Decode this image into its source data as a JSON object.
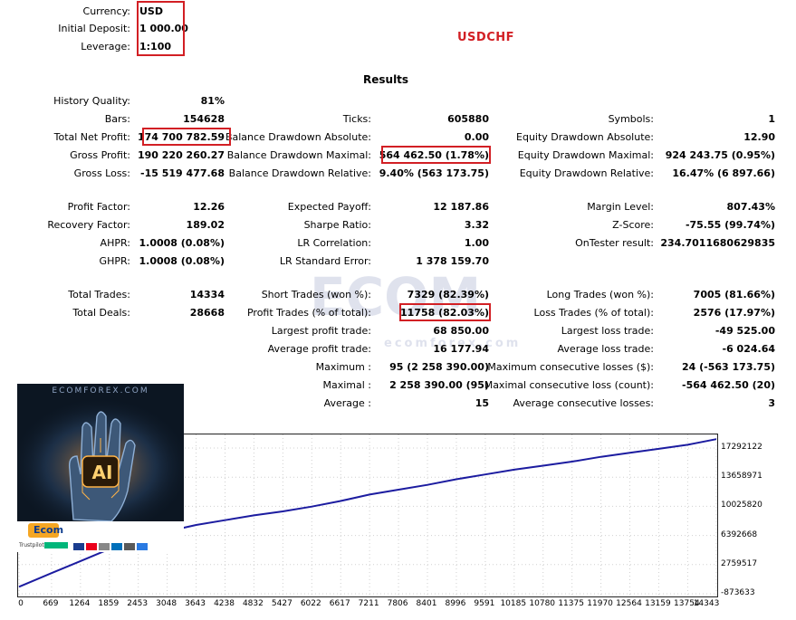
{
  "header": {
    "currency_label": "Currency:",
    "currency_value": "USD",
    "deposit_label": "Initial Deposit:",
    "deposit_value": "1 000.00",
    "leverage_label": "Leverage:",
    "leverage_value": "1:100",
    "symbol": "USDCHF",
    "results_title": "Results"
  },
  "stats": [
    {
      "label": "History Quality:",
      "value": "81%"
    },
    {
      "label": "Bars:",
      "value": "154628"
    },
    {
      "label": "Ticks:",
      "value": "605880"
    },
    {
      "label": "Symbols:",
      "value": "1"
    },
    {
      "label": "Total Net Profit:",
      "value": "174 700 782.59"
    },
    {
      "label": "Balance Drawdown Absolute:",
      "value": "0.00"
    },
    {
      "label": "Equity Drawdown Absolute:",
      "value": "12.90"
    },
    {
      "label": "Gross Profit:",
      "value": "190 220 260.27"
    },
    {
      "label": "Balance Drawdown Maximal:",
      "value": "564 462.50 (1.78%)"
    },
    {
      "label": "Equity Drawdown Maximal:",
      "value": "924 243.75 (0.95%)"
    },
    {
      "label": "Gross Loss:",
      "value": "-15 519 477.68"
    },
    {
      "label": "Balance Drawdown Relative:",
      "value": "9.40% (563 173.75)"
    },
    {
      "label": "Equity Drawdown Relative:",
      "value": "16.47% (6 897.66)"
    },
    {
      "label": "Profit Factor:",
      "value": "12.26"
    },
    {
      "label": "Expected Payoff:",
      "value": "12 187.86"
    },
    {
      "label": "Margin Level:",
      "value": "807.43%"
    },
    {
      "label": "Recovery Factor:",
      "value": "189.02"
    },
    {
      "label": "Sharpe Ratio:",
      "value": "3.32"
    },
    {
      "label": "Z-Score:",
      "value": "-75.55 (99.74%)"
    },
    {
      "label": "AHPR:",
      "value": "1.0008 (0.08%)"
    },
    {
      "label": "LR Correlation:",
      "value": "1.00"
    },
    {
      "label": "OnTester result:",
      "value": "234.7011680629835"
    },
    {
      "label": "GHPR:",
      "value": "1.0008 (0.08%)"
    },
    {
      "label": "LR Standard Error:",
      "value": "1 378 159.70"
    },
    {
      "label": "Total Trades:",
      "value": "14334"
    },
    {
      "label": "Short Trades (won %):",
      "value": "7329 (82.39%)"
    },
    {
      "label": "Long Trades (won %):",
      "value": "7005 (81.66%)"
    },
    {
      "label": "Total Deals:",
      "value": "28668"
    },
    {
      "label": "Profit Trades (% of total):",
      "value": "11758 (82.03%)"
    },
    {
      "label": "Loss Trades (% of total):",
      "value": "2576 (17.97%)"
    },
    {
      "label": "Largest profit trade:",
      "value": "68 850.00"
    },
    {
      "label": "Largest loss trade:",
      "value": "-49 525.00"
    },
    {
      "label": "Average profit trade:",
      "value": "16 177.94"
    },
    {
      "label": "Average loss trade:",
      "value": "-6 024.64"
    },
    {
      "label": "Maximum :",
      "value": "95 (2 258 390.00)"
    },
    {
      "label": "Maximum consecutive losses ($):",
      "value": "24 (-563 173.75)"
    },
    {
      "label": "Maximal :",
      "value": "2 258 390.00 (95)"
    },
    {
      "label": "Maximal consecutive loss (count):",
      "value": "-564 462.50 (20)"
    },
    {
      "label": "Average :",
      "value": "15"
    },
    {
      "label": "Average consecutive losses:",
      "value": "3"
    }
  ],
  "watermark": {
    "logo": "ECOM",
    "site": "ecomforex.com"
  },
  "promo": {
    "site": "ECOMFOREX.COM",
    "badge": "AI",
    "brand": "Ecom",
    "rating": "Trustpilot"
  },
  "chart_data": {
    "type": "line",
    "x_ticks": [
      "0",
      "669",
      "1264",
      "1859",
      "2453",
      "3048",
      "3643",
      "4238",
      "4832",
      "5427",
      "6022",
      "6617",
      "7211",
      "7806",
      "8401",
      "8996",
      "9591",
      "10185",
      "10780",
      "11375",
      "11970",
      "12564",
      "13159",
      "13754",
      "14343"
    ],
    "y_ticks": [
      "17292122",
      "13658971",
      "10025820",
      "6392668",
      "2759517",
      "-873633"
    ],
    "series": [
      {
        "color": "#1c1ca0",
        "x": [
          0,
          669,
          1264,
          1859,
          2453,
          3048,
          3643,
          4238,
          4832,
          5427,
          6022,
          6617,
          7211,
          7806,
          8401,
          8996,
          9591,
          10185,
          10780,
          11375,
          11970,
          12564,
          13159,
          13754,
          14343
        ],
        "y": [
          1000,
          1700000,
          3200000,
          4700000,
          5900000,
          6900000,
          7700000,
          8300000,
          8900000,
          9400000,
          10000000,
          10700000,
          11500000,
          12100000,
          12700000,
          13400000,
          14000000,
          14600000,
          15100000,
          15600000,
          16200000,
          16700000,
          17200000,
          17700000,
          18400000
        ]
      }
    ],
    "xlim": [
      0,
      14343
    ],
    "ylim": [
      -873633,
      18200000
    ]
  }
}
